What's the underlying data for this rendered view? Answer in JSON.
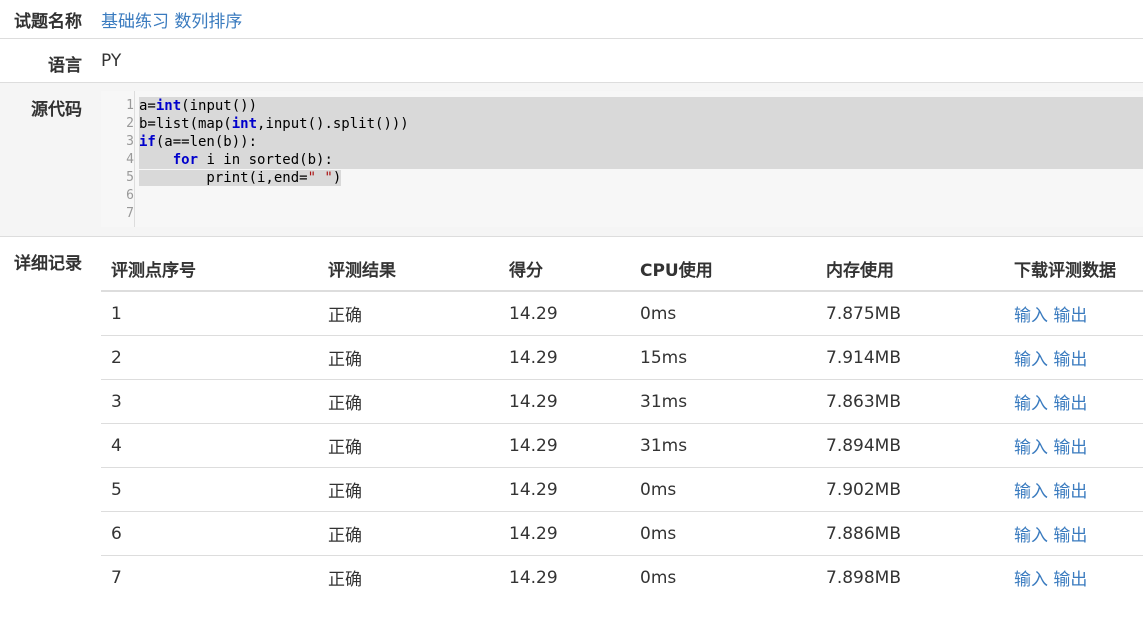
{
  "problem": {
    "label": "试题名称",
    "value": "基础练习 数列排序"
  },
  "language": {
    "label": "语言",
    "value": "PY"
  },
  "source": {
    "label": "源代码",
    "line_numbers": [
      "1",
      "2",
      "3",
      "4",
      "5",
      "6",
      "7"
    ]
  },
  "details": {
    "label": "详细记录",
    "headers": [
      "评测点序号",
      "评测结果",
      "得分",
      "CPU使用",
      "内存使用",
      "下载评测数据"
    ],
    "rows": [
      {
        "id": "1",
        "result": "正确",
        "score": "14.29",
        "cpu": "0ms",
        "mem": "7.875MB",
        "in": "输入",
        "out": "输出"
      },
      {
        "id": "2",
        "result": "正确",
        "score": "14.29",
        "cpu": "15ms",
        "mem": "7.914MB",
        "in": "输入",
        "out": "输出"
      },
      {
        "id": "3",
        "result": "正确",
        "score": "14.29",
        "cpu": "31ms",
        "mem": "7.863MB",
        "in": "输入",
        "out": "输出"
      },
      {
        "id": "4",
        "result": "正确",
        "score": "14.29",
        "cpu": "31ms",
        "mem": "7.894MB",
        "in": "输入",
        "out": "输出"
      },
      {
        "id": "5",
        "result": "正确",
        "score": "14.29",
        "cpu": "0ms",
        "mem": "7.902MB",
        "in": "输入",
        "out": "输出"
      },
      {
        "id": "6",
        "result": "正确",
        "score": "14.29",
        "cpu": "0ms",
        "mem": "7.886MB",
        "in": "输入",
        "out": "输出"
      },
      {
        "id": "7",
        "result": "正确",
        "score": "14.29",
        "cpu": "0ms",
        "mem": "7.898MB",
        "in": "输入",
        "out": "输出"
      }
    ]
  }
}
